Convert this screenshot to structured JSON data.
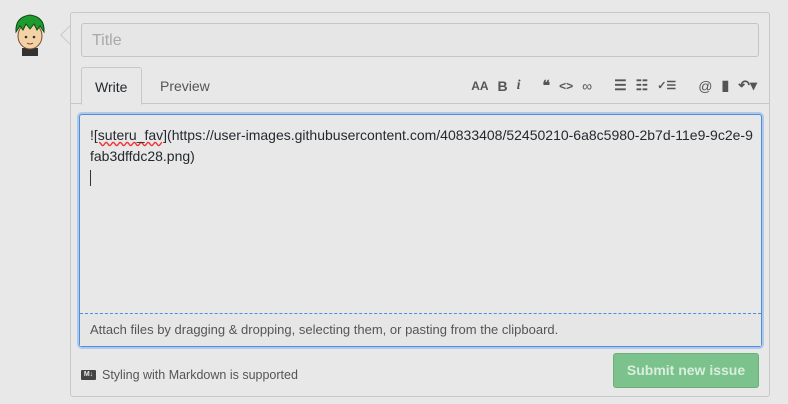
{
  "title_input": {
    "placeholder": "Title"
  },
  "tabs": [
    {
      "label": "Write"
    },
    {
      "label": "Preview"
    }
  ],
  "toolbar": {
    "heading": "AA",
    "bold": "B",
    "italic": "i",
    "quote": "❝",
    "code": "<>",
    "link": "∞",
    "ul": "☰",
    "ol": "☷",
    "task": "✓☰",
    "mention": "@",
    "ref": "▮",
    "reply": "↶▾"
  },
  "body": {
    "prefix": "!",
    "alt": "[suteru_fav]",
    "url": "(https://user-images.githubusercontent.com/40833408/52450210-6a8c5980-2b7d-11e9-9c2e-9fab3dffdc28.png)"
  },
  "attach_hint": "Attach files by dragging & dropping, selecting them, or pasting from the clipboard.",
  "markdown_icon": "M↓",
  "markdown_note": "Styling with Markdown is supported",
  "submit_label": "Submit new issue"
}
